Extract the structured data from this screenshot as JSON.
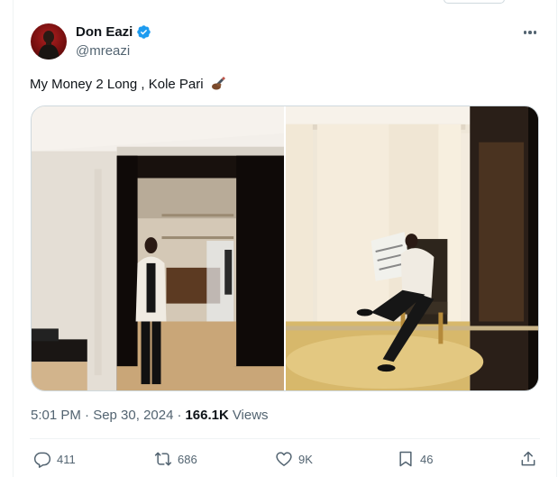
{
  "tweet": {
    "author": {
      "display_name": "Don Eazi",
      "handle": "@mreazi",
      "verified": true
    },
    "text": "My Money 2 Long , Kole Pari",
    "text_emoji": "writing-hand-emoji",
    "timestamp": "5:01 PM · Sep 30, 2024",
    "views_count": "166.1K",
    "views_label": "Views",
    "stats": {
      "replies": "411",
      "reposts": "686",
      "likes": "9K",
      "bookmarks": "46"
    },
    "media": [
      {
        "icon": "photo-closet-doorway"
      },
      {
        "icon": "photo-chair-newspaper"
      }
    ]
  },
  "colors": {
    "text_primary": "#0f1419",
    "text_secondary": "#536471",
    "verified_blue": "#1d9bf0",
    "border": "#eff3f4"
  }
}
